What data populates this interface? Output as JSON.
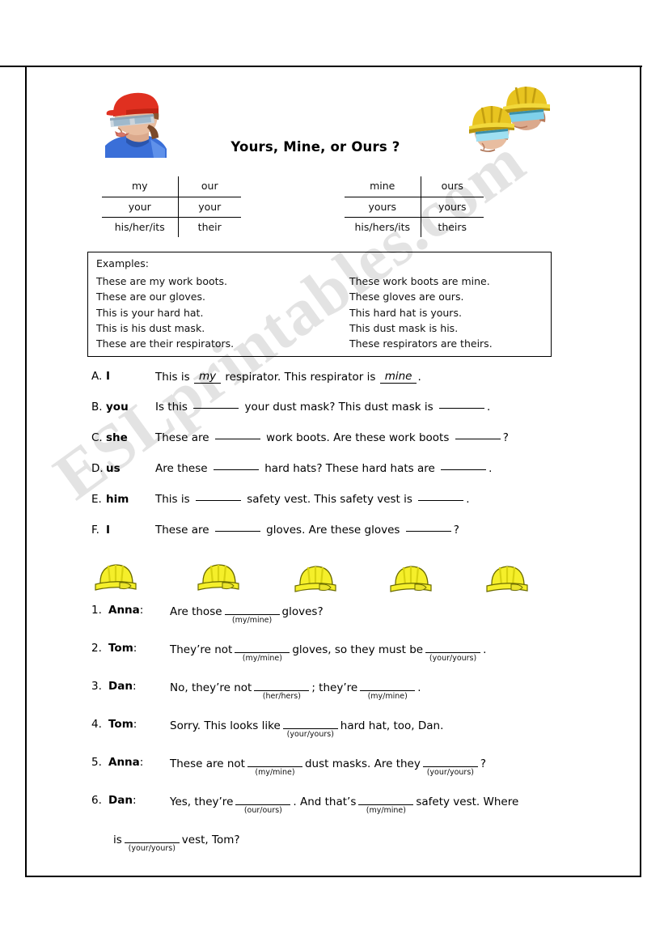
{
  "document": {
    "title": "Yours, Mine, or Ours ?",
    "watermark": "ESLprintables.com"
  },
  "clipart": {
    "left": "worker-red-cap-goggles-image",
    "right": "two-workers-yellow-hardhats-image",
    "hat": "yellow-hard-hat-icon"
  },
  "pronoun_tables": {
    "possessive_adjectives": {
      "rows": [
        {
          "singular": "my",
          "plural": "our"
        },
        {
          "singular": "your",
          "plural": "your"
        },
        {
          "singular": "his/her/its",
          "plural": "their"
        }
      ]
    },
    "possessive_pronouns": {
      "rows": [
        {
          "singular": "mine",
          "plural": "ours"
        },
        {
          "singular": "yours",
          "plural": "yours"
        },
        {
          "singular": "his/hers/its",
          "plural": "theirs"
        }
      ]
    }
  },
  "examples": {
    "heading": "Examples:",
    "left": [
      "These are my work boots.",
      "These are our gloves.",
      "This is your hard hat.",
      "This is his dust mask.",
      "These are their respirators."
    ],
    "right": [
      "These work boots are mine.",
      "These gloves are ours.",
      "This hard hat is yours.",
      "This dust mask is his.",
      "These respirators are theirs."
    ]
  },
  "letter_exercises": [
    {
      "mark": "A.",
      "pronoun": "I",
      "pre": "This is",
      "answer1": "my",
      "mid": "respirator.  This respirator is",
      "answer2": "mine",
      "post": "."
    },
    {
      "mark": "B.",
      "pronoun": "you",
      "pre": "Is this",
      "mid": "your dust mask?  This dust mask is",
      "post": "."
    },
    {
      "mark": "C.",
      "pronoun": "she",
      "pre": "These are",
      "mid": "work boots.  Are these work boots",
      "post": "?"
    },
    {
      "mark": "D.",
      "pronoun": "us",
      "pre": "Are these",
      "mid": "hard hats?  These hard hats are",
      "post": "."
    },
    {
      "mark": "E.",
      "pronoun": "him",
      "pre": "This is",
      "mid": "safety vest.  This safety vest is",
      "post": "."
    },
    {
      "mark": "F.",
      "pronoun": "I",
      "pre": "These are",
      "mid": "gloves.  Are these gloves",
      "post": "?"
    }
  ],
  "hard_hats_count": 5,
  "dialogue": [
    {
      "num": "1.",
      "speaker": "Anna",
      "colon": ":",
      "pre": "Are those",
      "hint1": "(my/mine)",
      "post": "gloves?"
    },
    {
      "num": "2.",
      "speaker": "Tom",
      "colon": ":",
      "pre": "They’re not",
      "hint1": "(my/mine)",
      "mid": "gloves, so they must be",
      "hint2": "(your/yours)",
      "post": "."
    },
    {
      "num": "3.",
      "speaker": "Dan",
      "colon": ":",
      "pre": "No, they’re not",
      "hint1": "(her/hers)",
      "mid": "; they’re",
      "hint2": "(my/mine)",
      "post": "."
    },
    {
      "num": "4.",
      "speaker": "Tom",
      "colon": ":",
      "pre": "Sorry.  This looks like",
      "hint1": "(your/yours)",
      "post": "hard hat, too, Dan."
    },
    {
      "num": "5.",
      "speaker": "Anna",
      "colon": ":",
      "pre": "These are not",
      "hint1": "(my/mine)",
      "mid": "dust masks.  Are they",
      "hint2": "(your/yours)",
      "post": "?"
    },
    {
      "num": "6.",
      "speaker": "Dan",
      "colon": ":",
      "pre": "Yes, they’re",
      "hint1": "(our/ours)",
      "mid": ".  And that’s",
      "hint2": "(my/mine)",
      "post": "safety vest.  Where",
      "cont_pre": "is",
      "cont_hint": "(your/yours)",
      "cont_post": "vest, Tom?"
    }
  ],
  "colors": {
    "hat_yellow": "#f5ef2a",
    "hat_outline": "#3a3a00",
    "cap_red": "#e03020",
    "shirt_blue": "#3a6fd8",
    "goggle_blue": "#8fd8ee",
    "skin": "#e8bda0",
    "text": "#000000"
  }
}
